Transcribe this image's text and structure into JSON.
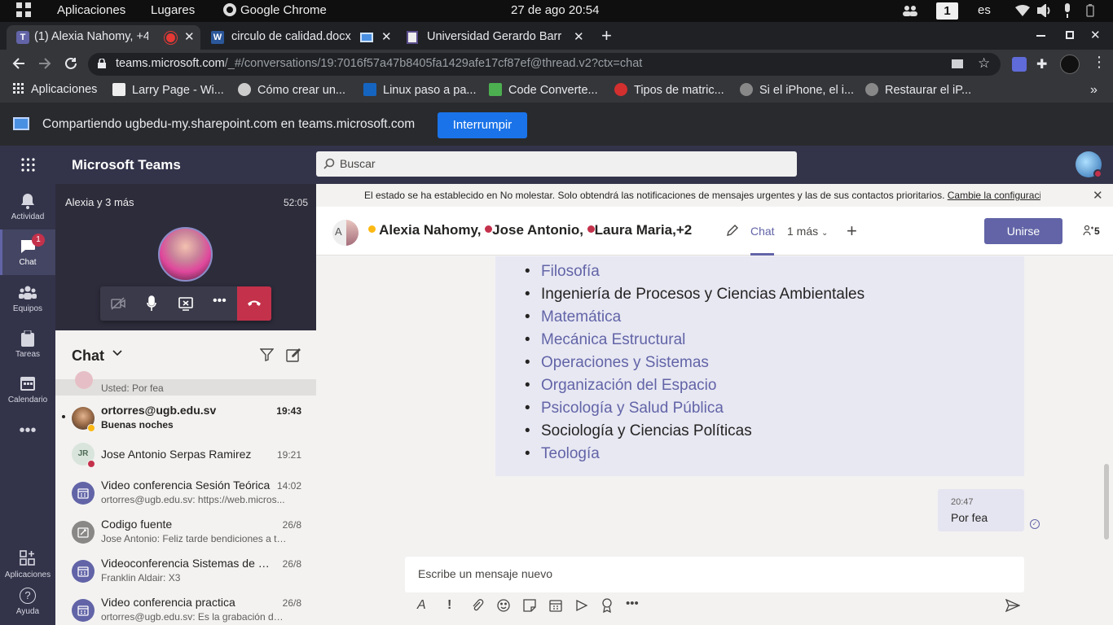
{
  "gnome": {
    "apps": "Aplicaciones",
    "places": "Lugares",
    "chrome": "Google Chrome",
    "clock": "27 de ago  20:54",
    "workspace": "1",
    "lang": "es"
  },
  "tabs": [
    {
      "title": "(1) Alexia Nahomy, +4"
    },
    {
      "title": "circulo de calidad.docx"
    },
    {
      "title": "Universidad Gerardo Barr"
    }
  ],
  "address": {
    "host": "teams.microsoft.com",
    "path": "/_#/conversations/19:7016f57a47b8405fa1429afe17cf87ef@thread.v2?ctx=chat"
  },
  "bookmarks": [
    "Aplicaciones",
    "Larry Page - Wi...",
    "Cómo crear un...",
    "Linux paso a pa...",
    "Code Converte...",
    "Tipos de matric...",
    "Si el iPhone, el i...",
    "Restaurar el iP..."
  ],
  "share": {
    "text": "Compartiendo ugbedu-my.sharepoint.com en teams.microsoft.com",
    "stop": "Interrumpir"
  },
  "teams": {
    "brand": "Microsoft Teams",
    "search_placeholder": "Buscar"
  },
  "rail": [
    {
      "label": "Actividad"
    },
    {
      "label": "Chat",
      "badge": "1"
    },
    {
      "label": "Equipos"
    },
    {
      "label": "Tareas"
    },
    {
      "label": "Calendario"
    },
    {
      "label": "Aplicaciones"
    },
    {
      "label": "Ayuda"
    }
  ],
  "call": {
    "title": "Alexia y 3 más",
    "duration": "52:05"
  },
  "chatlist": {
    "header": "Chat",
    "partial_preview": "Usted: Por fea",
    "items": [
      {
        "name": "ortorres@ugb.edu.sv",
        "preview": "Buenas noches",
        "time": "19:43",
        "unread": true
      },
      {
        "name": "Jose Antonio Serpas Ramirez",
        "preview": "",
        "time": "19:21",
        "initials": "JR"
      },
      {
        "name": "Video conferencia Sesión Teórica",
        "preview": "ortorres@ugb.edu.sv: https://web.micros...",
        "time": "14:02"
      },
      {
        "name": "Codigo fuente",
        "preview": "Jose Antonio: Feliz tarde bendiciones a to...",
        "time": "26/8"
      },
      {
        "name": "Videoconferencia Sistemas de C...",
        "preview": "Franklin Aldair: X3",
        "time": "26/8"
      },
      {
        "name": "Video conferencia practica",
        "preview": "ortorres@ugb.edu.sv: Es la grabación del ...",
        "time": "26/8"
      }
    ]
  },
  "banner": {
    "text": "El estado se ha establecido en No molestar. Solo obtendrá las notificaciones de mensajes urgentes y las de sus contactos prioritarios. ",
    "link": "Cambie la configuració"
  },
  "conversation": {
    "avatar_initial": "A",
    "participants": [
      "Alexia Nahomy,",
      "Jose Antonio,",
      "Laura Maria,",
      "+2"
    ],
    "tab_chat": "Chat",
    "tab_more": "1 más",
    "join": "Unirse",
    "people_count": "5",
    "list": [
      {
        "text": "Filosofía",
        "link": true
      },
      {
        "text": "Ingeniería de Procesos y Ciencias Ambientales",
        "link": false
      },
      {
        "text": "Matemática",
        "link": true
      },
      {
        "text": "Mecánica Estructural",
        "link": true
      },
      {
        "text": "Operaciones y Sistemas",
        "link": true
      },
      {
        "text": "Organización del Espacio",
        "link": true
      },
      {
        "text": "Psicología y Salud Pública",
        "link": true
      },
      {
        "text": "Sociología y Ciencias Políticas",
        "link": false
      },
      {
        "text": "Teología",
        "link": true
      }
    ],
    "my_message": {
      "time": "20:47",
      "text": "Por fea"
    },
    "compose_placeholder": "Escribe un mensaje nuevo"
  },
  "colors": {
    "teams_purple": "#6264a7",
    "rail_bg": "#33344a",
    "hangup": "#c4314b",
    "chrome_blue": "#1a73e8"
  }
}
